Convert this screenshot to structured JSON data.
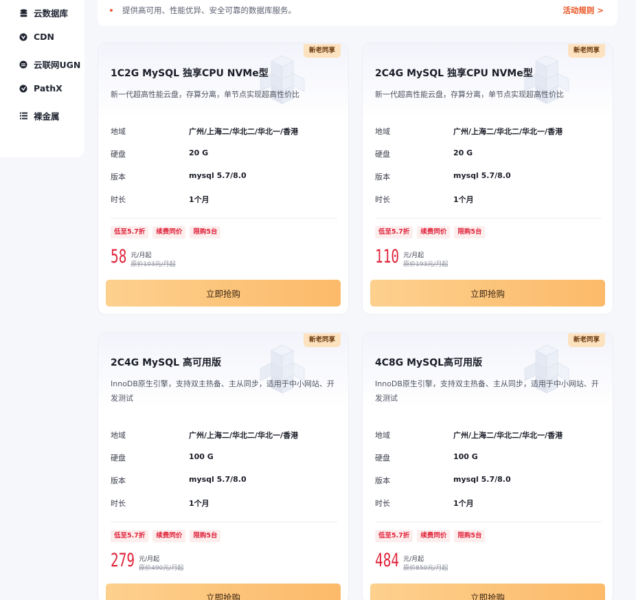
{
  "sidebar": {
    "items": [
      {
        "label": "云数据库",
        "icon": "database-icon"
      },
      {
        "label": "CDN",
        "icon": "cdn-icon"
      },
      {
        "label": "云联网UGN",
        "icon": "network-icon"
      },
      {
        "label": "PathX",
        "icon": "pathx-icon"
      },
      {
        "label": "裸金属",
        "icon": "server-list-icon"
      }
    ]
  },
  "notice": {
    "text": "提供高可用、性能优异、安全可靠的数据库服务。",
    "rule_link": "活动规则 >"
  },
  "spec_labels": {
    "region": "地域",
    "disk": "硬盘",
    "version": "版本",
    "duration": "时长"
  },
  "cards": [
    {
      "badge": "新老同享",
      "title": "1C2G MySQL 独享CPU NVMe型",
      "desc": "新一代超高性能云盘，存算分离，单节点实现超高性价比",
      "region": "广州/上海二/华北二/华北一/香港",
      "disk": "20 G",
      "version": "mysql 5.7/8.0",
      "duration": "1个月",
      "tags": [
        "低至5.7折",
        "续费同价",
        "限购5台"
      ],
      "price": "58",
      "unit": "元/月起",
      "original": "原价103元/月起",
      "button": "立即抢购"
    },
    {
      "badge": "新老同享",
      "title": "2C4G MySQL 独享CPU NVMe型",
      "desc": "新一代超高性能云盘，存算分离，单节点实现超高性价比",
      "region": "广州/上海二/华北二/华北一/香港",
      "disk": "20 G",
      "version": "mysql 5.7/8.0",
      "duration": "1个月",
      "tags": [
        "低至5.7折",
        "续费同价",
        "限购5台"
      ],
      "price": "110",
      "unit": "元/月起",
      "original": "原价193元/月起",
      "button": "立即抢购"
    },
    {
      "badge": "新老同享",
      "title": "2C4G MySQL 高可用版",
      "desc": "InnoDB原生引擎，支持双主热备、主从同步，适用于中小网站、开发测试",
      "region": "广州/上海二/华北二/华北一/香港",
      "disk": "100 G",
      "version": "mysql 5.7/8.0",
      "duration": "1个月",
      "tags": [
        "低至5.7折",
        "续费同价",
        "限购5台"
      ],
      "price": "279",
      "unit": "元/月起",
      "original": "原价490元/月起",
      "button": "立即抢购"
    },
    {
      "badge": "新老同享",
      "title": "4C8G MySQL高可用版",
      "desc": "InnoDB原生引擎，支持双主热备、主从同步，适用于中小网站、开发测试",
      "region": "广州/上海二/华北二/华北一/香港",
      "disk": "100 G",
      "version": "mysql 5.7/8.0",
      "duration": "1个月",
      "tags": [
        "低至5.7折",
        "续费同价",
        "限购5台"
      ],
      "price": "484",
      "unit": "元/月起",
      "original": "原价850元/月起",
      "button": "立即抢购"
    }
  ]
}
